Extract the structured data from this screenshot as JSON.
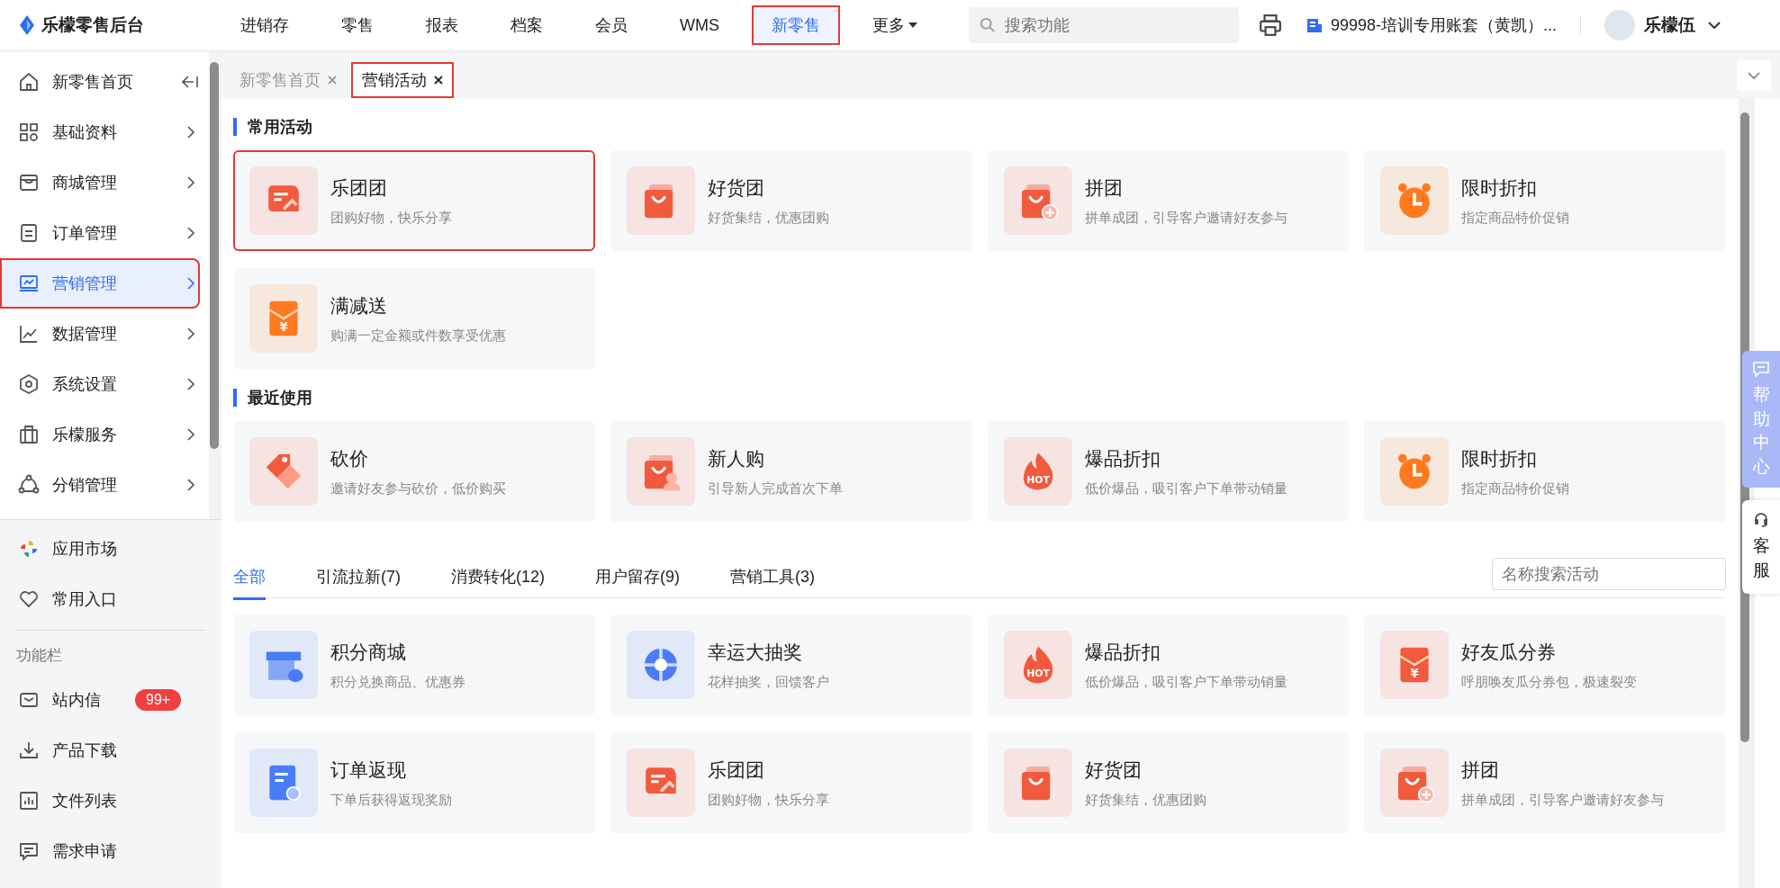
{
  "top_bar": {
    "logo": "乐檬零售后台",
    "nav": [
      {
        "label": "进销存",
        "selected": false,
        "annotated": false
      },
      {
        "label": "零售",
        "selected": false,
        "annotated": false
      },
      {
        "label": "报表",
        "selected": false,
        "annotated": false
      },
      {
        "label": "档案",
        "selected": false,
        "annotated": false
      },
      {
        "label": "会员",
        "selected": false,
        "annotated": false
      },
      {
        "label": "WMS",
        "selected": false,
        "annotated": false
      },
      {
        "label": "新零售",
        "selected": true,
        "annotated": true
      }
    ],
    "more": "更多",
    "search": {
      "placeholder": "搜索功能"
    },
    "account": "99998-培训专用账套（黄凯）...",
    "user": "乐檬伍"
  },
  "sidebar": {
    "items": [
      {
        "label": "新零售首页",
        "kind": "home",
        "selected": false,
        "annotated": false
      },
      {
        "label": "基础资料",
        "kind": "grid",
        "selected": false,
        "annotated": false
      },
      {
        "label": "商城管理",
        "kind": "store",
        "selected": false,
        "annotated": false
      },
      {
        "label": "订单管理",
        "kind": "list",
        "selected": false,
        "annotated": false
      },
      {
        "label": "营销管理",
        "kind": "monitor",
        "selected": true,
        "annotated": true
      },
      {
        "label": "数据管理",
        "kind": "chart",
        "selected": false,
        "annotated": false
      },
      {
        "label": "系统设置",
        "kind": "hexagon",
        "selected": false,
        "annotated": false
      },
      {
        "label": "乐檬服务",
        "kind": "case",
        "selected": false,
        "annotated": false
      },
      {
        "label": "分销管理",
        "kind": "share",
        "selected": false,
        "annotated": false
      }
    ],
    "quick": [
      {
        "label": "应用市场",
        "kind": "apps"
      },
      {
        "label": "常用入口",
        "kind": "heart"
      }
    ],
    "tools_heading": "功能栏",
    "tools": [
      {
        "label": "站内信",
        "kind": "mail",
        "badge": "99+"
      },
      {
        "label": "产品下载",
        "kind": "download"
      },
      {
        "label": "文件列表",
        "kind": "bars"
      },
      {
        "label": "需求申请",
        "kind": "message"
      }
    ]
  },
  "page_tabs": [
    {
      "label": "新零售首页",
      "selected": false,
      "annotated": false
    },
    {
      "label": "营销活动",
      "selected": true,
      "annotated": true
    }
  ],
  "sections": [
    {
      "title": "常用活动",
      "cards": [
        {
          "title": "乐团团",
          "desc": "团购好物，快乐分享",
          "kind": "group",
          "color": "#f25a3e",
          "annotated": true
        },
        {
          "title": "好货团",
          "desc": "好货集结，优惠团购",
          "kind": "bag",
          "color": "#f25a3e",
          "annotated": false
        },
        {
          "title": "拼团",
          "desc": "拼单成团，引导客户邀请好友参与",
          "kind": "bag-plus",
          "color": "#f25a3e",
          "annotated": false
        },
        {
          "title": "限时折扣",
          "desc": "指定商品特价促销",
          "kind": "clock",
          "color": "#ff7a1f",
          "annotated": false
        },
        {
          "title": "满减送",
          "desc": "购满一定金额或件数享受优惠",
          "kind": "envelope",
          "color": "#ff7a1f",
          "annotated": false,
          "icon_text": "¥"
        }
      ]
    },
    {
      "title": "最近使用",
      "cards": [
        {
          "title": "砍价",
          "desc": "邀请好友参与砍价，低价购买",
          "kind": "tag",
          "color": "#f25a3e",
          "annotated": false
        },
        {
          "title": "新人购",
          "desc": "引导新人完成首次下单",
          "kind": "bag-person",
          "color": "#f25a3e",
          "annotated": false
        },
        {
          "title": "爆品折扣",
          "desc": "低价爆品，吸引客户下单带动销量",
          "kind": "hot",
          "color": "#f25a3e",
          "annotated": false,
          "icon_text": "HOT"
        },
        {
          "title": "限时折扣",
          "desc": "指定商品特价促销",
          "kind": "clock",
          "color": "#ff7a1f",
          "annotated": false
        }
      ]
    }
  ],
  "filter_tabs": [
    {
      "label": "全部",
      "selected": true
    },
    {
      "label": "引流拉新(7)",
      "selected": false
    },
    {
      "label": "消费转化(12)",
      "selected": false
    },
    {
      "label": "用户留存(9)",
      "selected": false
    },
    {
      "label": "营销工具(3)",
      "selected": false
    }
  ],
  "activity_search": {
    "placeholder": "名称搜索活动"
  },
  "activities": [
    {
      "title": "积分商城",
      "desc": "积分兑换商品、优惠券",
      "kind": "store",
      "color": "#4a7cf7"
    },
    {
      "title": "幸运大抽奖",
      "desc": "花样抽奖，回馈客户",
      "kind": "wheel",
      "color": "#4a7cf7"
    },
    {
      "title": "爆品折扣",
      "desc": "低价爆品，吸引客户下单带动销量",
      "kind": "hot",
      "color": "#f25a3e",
      "icon_text": "HOT"
    },
    {
      "title": "好友瓜分券",
      "desc": "呼朋唤友瓜分券包，极速裂变",
      "kind": "envelope",
      "color": "#f25a3e",
      "icon_text": "¥"
    },
    {
      "title": "订单返现",
      "desc": "下单后获得返现奖励",
      "kind": "document",
      "color": "#4a7cf7"
    },
    {
      "title": "乐团团",
      "desc": "团购好物，快乐分享",
      "kind": "group",
      "color": "#f25a3e"
    },
    {
      "title": "好货团",
      "desc": "好货集结，优惠团购",
      "kind": "bag",
      "color": "#f25a3e"
    },
    {
      "title": "拼团",
      "desc": "拼单成团，引导客户邀请好友参与",
      "kind": "bag-plus",
      "color": "#f25a3e"
    }
  ],
  "help": {
    "label": "帮助中心",
    "service": "客服"
  }
}
